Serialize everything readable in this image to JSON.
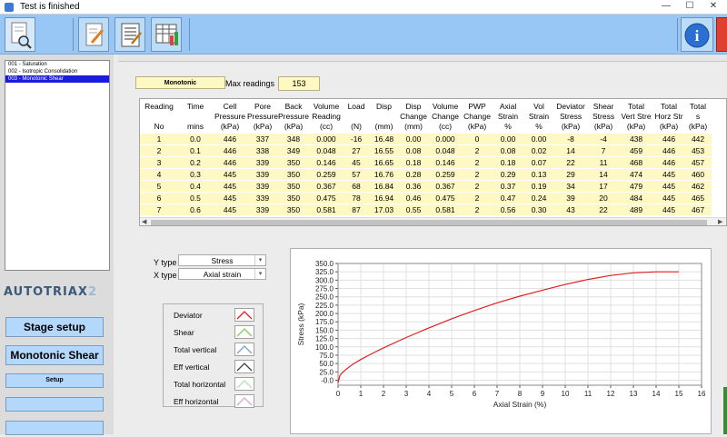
{
  "window": {
    "title": "Test is finished",
    "controls": [
      "—",
      "☐",
      "✕"
    ]
  },
  "toolbar": {
    "buttons": [
      "zoom-document",
      "edit",
      "report",
      "chart-data"
    ],
    "right_buttons": [
      "info",
      "close"
    ]
  },
  "tests": [
    {
      "label": "001 - Saturation",
      "selected": false
    },
    {
      "label": "002 - Isotropic Consolidation",
      "selected": false
    },
    {
      "label": "003 - Monotonic Shear",
      "selected": true
    }
  ],
  "brand": {
    "text": "AUTOTRIAX",
    "suffix": "2"
  },
  "left_buttons": {
    "stage_setup": "Stage setup",
    "monotonic_shear": "Monotonic Shear",
    "setup": "Setup"
  },
  "mode": "Monotonic",
  "max_readings": {
    "label": "Max readings",
    "value": "153"
  },
  "table": {
    "headers": [
      [
        "Reading",
        "",
        "No"
      ],
      [
        "Time",
        "",
        "mins"
      ],
      [
        "Cell",
        "Pressure",
        "(kPa)"
      ],
      [
        "Pore",
        "Pressure",
        "(kPa)"
      ],
      [
        "Back",
        "Pressure",
        "(kPa)"
      ],
      [
        "Volume",
        "Reading",
        "(cc)"
      ],
      [
        "Load",
        "",
        "(N)"
      ],
      [
        "Disp",
        "",
        "(mm)"
      ],
      [
        "Disp",
        "Change",
        "(mm)"
      ],
      [
        "Volume",
        "Change",
        "(cc)"
      ],
      [
        "PWP",
        "Change",
        "(kPa)"
      ],
      [
        "Axial",
        "Strain",
        "%"
      ],
      [
        "Vol",
        "Strain",
        "%"
      ],
      [
        "Deviator",
        "Stress",
        "(kPa)"
      ],
      [
        "Shear",
        "Stress",
        "(kPa)"
      ],
      [
        "Total",
        "Vert Stre",
        "(kPa)"
      ],
      [
        "Total",
        "Horz Str",
        "(kPa)"
      ],
      [
        "Total",
        "s",
        "(kPa)"
      ]
    ],
    "rows": [
      [
        "1",
        "0.0",
        "446",
        "337",
        "348",
        "0.000",
        "-16",
        "16.48",
        "0.00",
        "0.000",
        "0",
        "0.00",
        "0.00",
        "-8",
        "-4",
        "438",
        "446",
        "442"
      ],
      [
        "2",
        "0.1",
        "446",
        "338",
        "349",
        "0.048",
        "27",
        "16.55",
        "0.08",
        "0.048",
        "2",
        "0.08",
        "0.02",
        "14",
        "7",
        "459",
        "446",
        "453"
      ],
      [
        "3",
        "0.2",
        "446",
        "339",
        "350",
        "0.146",
        "45",
        "16.65",
        "0.18",
        "0.146",
        "2",
        "0.18",
        "0.07",
        "22",
        "11",
        "468",
        "446",
        "457"
      ],
      [
        "4",
        "0.3",
        "445",
        "339",
        "350",
        "0.259",
        "57",
        "16.76",
        "0.28",
        "0.259",
        "2",
        "0.29",
        "0.13",
        "29",
        "14",
        "474",
        "445",
        "460"
      ],
      [
        "5",
        "0.4",
        "445",
        "339",
        "350",
        "0.367",
        "68",
        "16.84",
        "0.36",
        "0.367",
        "2",
        "0.37",
        "0.19",
        "34",
        "17",
        "479",
        "445",
        "462"
      ],
      [
        "6",
        "0.5",
        "445",
        "339",
        "350",
        "0.475",
        "78",
        "16.94",
        "0.46",
        "0.475",
        "2",
        "0.47",
        "0.24",
        "39",
        "20",
        "484",
        "445",
        "465"
      ],
      [
        "7",
        "0.6",
        "445",
        "339",
        "350",
        "0.581",
        "87",
        "17.03",
        "0.55",
        "0.581",
        "2",
        "0.56",
        "0.30",
        "43",
        "22",
        "489",
        "445",
        "467"
      ]
    ]
  },
  "plot_controls": {
    "y_type_label": "Y type",
    "y_type_value": "Stress",
    "x_type_label": "X type",
    "x_type_value": "Axial strain"
  },
  "legend": [
    {
      "label": "Deviator",
      "color": "#e02020"
    },
    {
      "label": "Shear",
      "color": "#7ecf5a"
    },
    {
      "label": "Total vertical",
      "color": "#7a9fe0"
    },
    {
      "label": "Eff vertical",
      "color": "#404040"
    },
    {
      "label": "Total horizontal",
      "color": "#b8e0b8"
    },
    {
      "label": "Eff horizontal",
      "color": "#e0a0e0"
    }
  ],
  "chart_data": {
    "type": "line",
    "xlabel": "Axial Strain (%)",
    "ylabel": "Stress (kPa)",
    "xlim": [
      0,
      16
    ],
    "ylim": [
      -15,
      350
    ],
    "xticks": [
      "0",
      "1",
      "2",
      "3",
      "4",
      "5",
      "6",
      "7",
      "8",
      "9",
      "10",
      "11",
      "12",
      "13",
      "14",
      "15",
      "16"
    ],
    "yticks": [
      "-0.0",
      "25.0",
      "50.0",
      "75.0",
      "100.0",
      "125.0",
      "150.0",
      "175.0",
      "200.0",
      "225.0",
      "250.0",
      "275.0",
      "300.0",
      "325.0",
      "350.0"
    ],
    "grid": true,
    "series": [
      {
        "color": "#e02020",
        "x": [
          0,
          0.08,
          0.18,
          0.29,
          0.47,
          0.7,
          1,
          1.5,
          2,
          3,
          4,
          5,
          6,
          7,
          8,
          9,
          10,
          11,
          12,
          13,
          14,
          15
        ],
        "y": [
          -8,
          14,
          22,
          29,
          39,
          50,
          62,
          80,
          97,
          128,
          157,
          184,
          209,
          232,
          252,
          270,
          287,
          302,
          314,
          322,
          325,
          325
        ]
      }
    ]
  }
}
